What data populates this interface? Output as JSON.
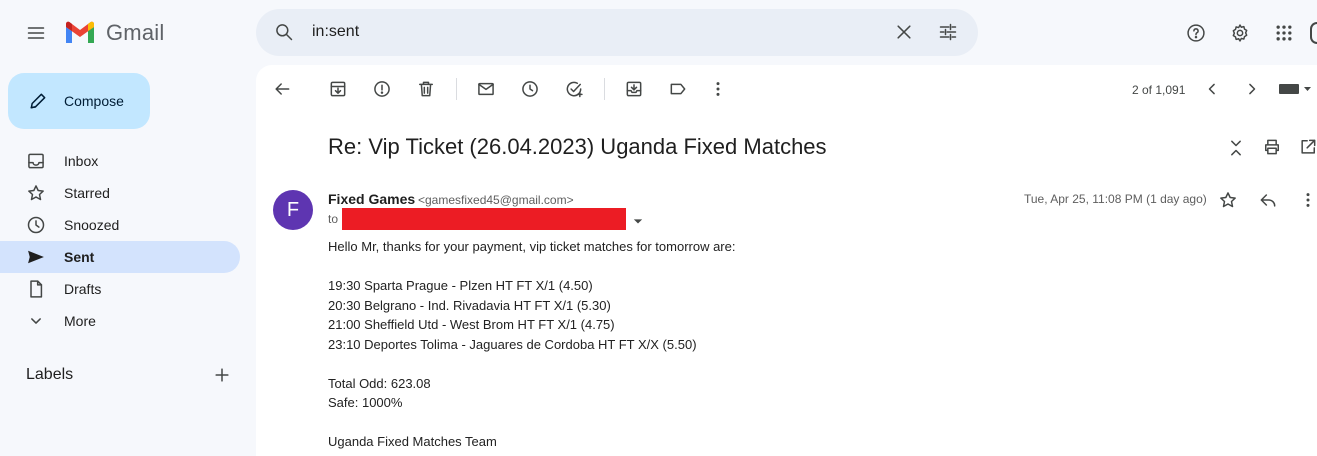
{
  "header": {
    "brand": "Gmail",
    "search_query": "in:sent"
  },
  "sidebar": {
    "compose_label": "Compose",
    "items": [
      {
        "label": "Inbox",
        "icon": "inbox-icon",
        "active": false
      },
      {
        "label": "Starred",
        "icon": "star-icon",
        "active": false
      },
      {
        "label": "Snoozed",
        "icon": "clock-icon",
        "active": false
      },
      {
        "label": "Sent",
        "icon": "send-icon",
        "active": true
      },
      {
        "label": "Drafts",
        "icon": "draft-icon",
        "active": false
      },
      {
        "label": "More",
        "icon": "chevron-down-icon",
        "active": false
      }
    ],
    "labels_title": "Labels"
  },
  "toolbar": {
    "pager": "2 of 1,091"
  },
  "message": {
    "subject": "Re: Vip Ticket (26.04.2023) Uganda Fixed Matches",
    "sender_initial": "F",
    "sender_name": "Fixed Games",
    "sender_email": "<gamesfixed45@gmail.com>",
    "to_label": "to",
    "timestamp": "Tue, Apr 25, 11:08 PM (1 day ago)",
    "body": {
      "greeting": "Hello Mr, thanks for your payment, vip ticket matches for tomorrow are:",
      "matches": [
        "19:30 Sparta Prague - Plzen HT FT X/1 (4.50)",
        "20:30 Belgrano - Ind. Rivadavia HT FT X/1 (5.30)",
        "21:00 Sheffield Utd - West Brom HT FT X/1 (4.75)",
        "23:10 Deportes Tolima - Jaguares de Cordoba HT FT X/X (5.50)"
      ],
      "total_odd": "Total Odd: 623.08",
      "safe": "Safe: 1000%",
      "signature": "Uganda Fixed Matches Team"
    }
  },
  "colors": {
    "accent_sent_bg": "#d3e3fd",
    "compose_bg": "#c2e7ff",
    "avatar_bg": "#5e35b1",
    "redaction": "#ec1c24"
  }
}
